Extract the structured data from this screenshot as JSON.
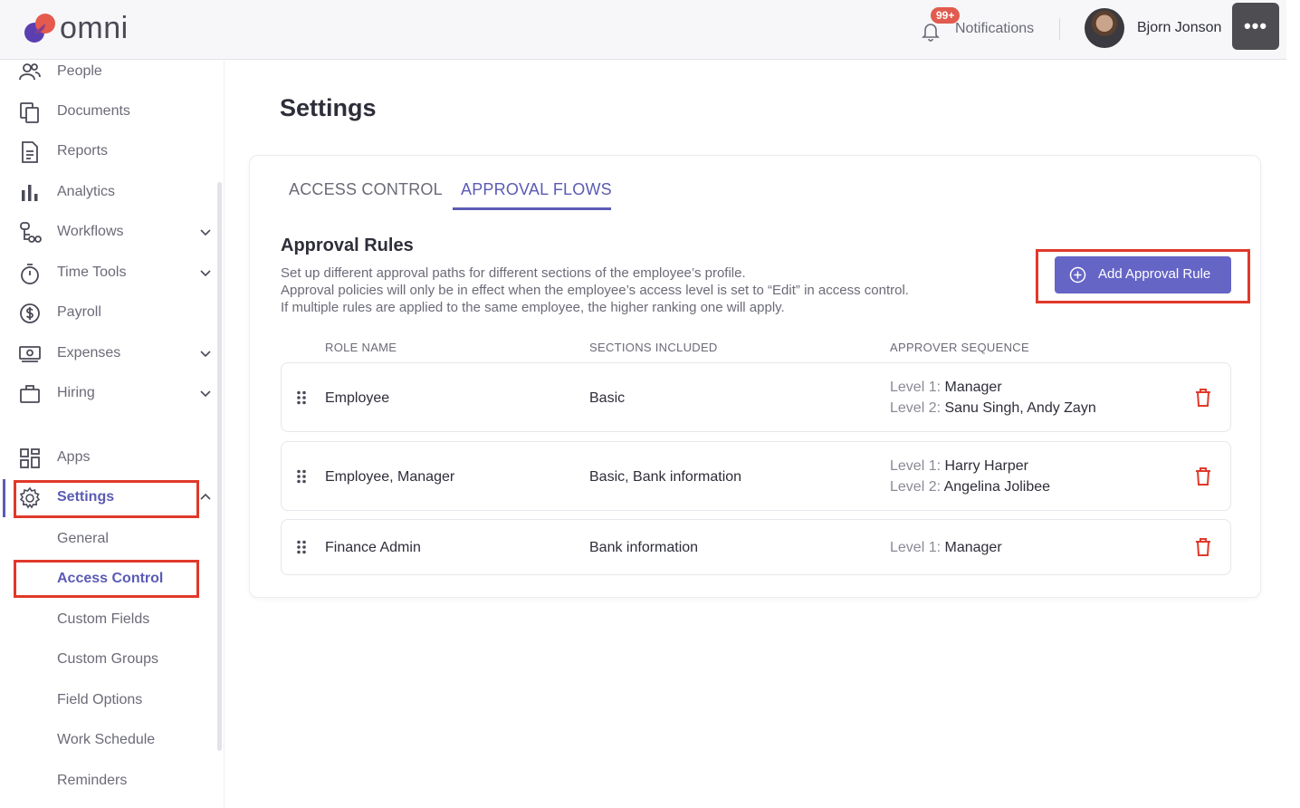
{
  "header": {
    "logo_text": "omni",
    "notifications_badge": "99+",
    "notifications_label": "Notifications",
    "user_name": "Bjorn Jonson",
    "more_label": "•••"
  },
  "sidebar": {
    "items": [
      {
        "label": "People",
        "icon": "people-icon"
      },
      {
        "label": "Documents",
        "icon": "documents-icon"
      },
      {
        "label": "Reports",
        "icon": "reports-icon"
      },
      {
        "label": "Analytics",
        "icon": "analytics-icon"
      },
      {
        "label": "Workflows",
        "icon": "workflows-icon",
        "expandable": true
      },
      {
        "label": "Time Tools",
        "icon": "stopwatch-icon",
        "expandable": true
      },
      {
        "label": "Payroll",
        "icon": "dollar-icon"
      },
      {
        "label": "Expenses",
        "icon": "money-icon",
        "expandable": true
      },
      {
        "label": "Hiring",
        "icon": "briefcase-icon",
        "expandable": true
      },
      {
        "label": "Apps",
        "icon": "apps-icon"
      },
      {
        "label": "Settings",
        "icon": "gear-icon",
        "expanded": true,
        "active": true
      }
    ],
    "settings_sub": [
      {
        "label": "General"
      },
      {
        "label": "Access Control",
        "active": true
      },
      {
        "label": "Custom Fields"
      },
      {
        "label": "Custom Groups"
      },
      {
        "label": "Field Options"
      },
      {
        "label": "Work Schedule"
      },
      {
        "label": "Reminders"
      }
    ]
  },
  "main": {
    "page_title": "Settings",
    "tabs": [
      {
        "label": "ACCESS CONTROL",
        "active": false
      },
      {
        "label": "APPROVAL FLOWS",
        "active": true
      }
    ],
    "section_title": "Approval Rules",
    "description": [
      "Set up different approval paths for different sections of the employee’s profile.",
      "Approval policies will only be in effect when the employee’s access level is set to “Edit” in access control.",
      "If multiple rules are applied to the same employee, the higher ranking one will apply."
    ],
    "add_button_label": "Add Approval Rule",
    "columns": [
      "ROLE NAME",
      "SECTIONS INCLUDED",
      "APPROVER SEQUENCE"
    ],
    "rules": [
      {
        "role": "Employee",
        "sections": "Basic",
        "approvers": [
          {
            "level": "Level 1:",
            "names": "Manager"
          },
          {
            "level": "Level 2:",
            "names": "Sanu Singh, Andy Zayn"
          }
        ]
      },
      {
        "role": "Employee, Manager",
        "sections": "Basic, Bank information",
        "approvers": [
          {
            "level": "Level 1:",
            "names": "Harry Harper"
          },
          {
            "level": "Level 2:",
            "names": "Angelina Jolibee"
          }
        ]
      },
      {
        "role": "Finance Admin",
        "sections": "Bank information",
        "approvers": [
          {
            "level": "Level 1:",
            "names": "Manager"
          }
        ]
      }
    ]
  },
  "colors": {
    "accent": "#5b5bb5",
    "button": "#6565c6",
    "highlight": "#e0392a",
    "trash": "#e0392a",
    "badge": "#e15b4f"
  }
}
